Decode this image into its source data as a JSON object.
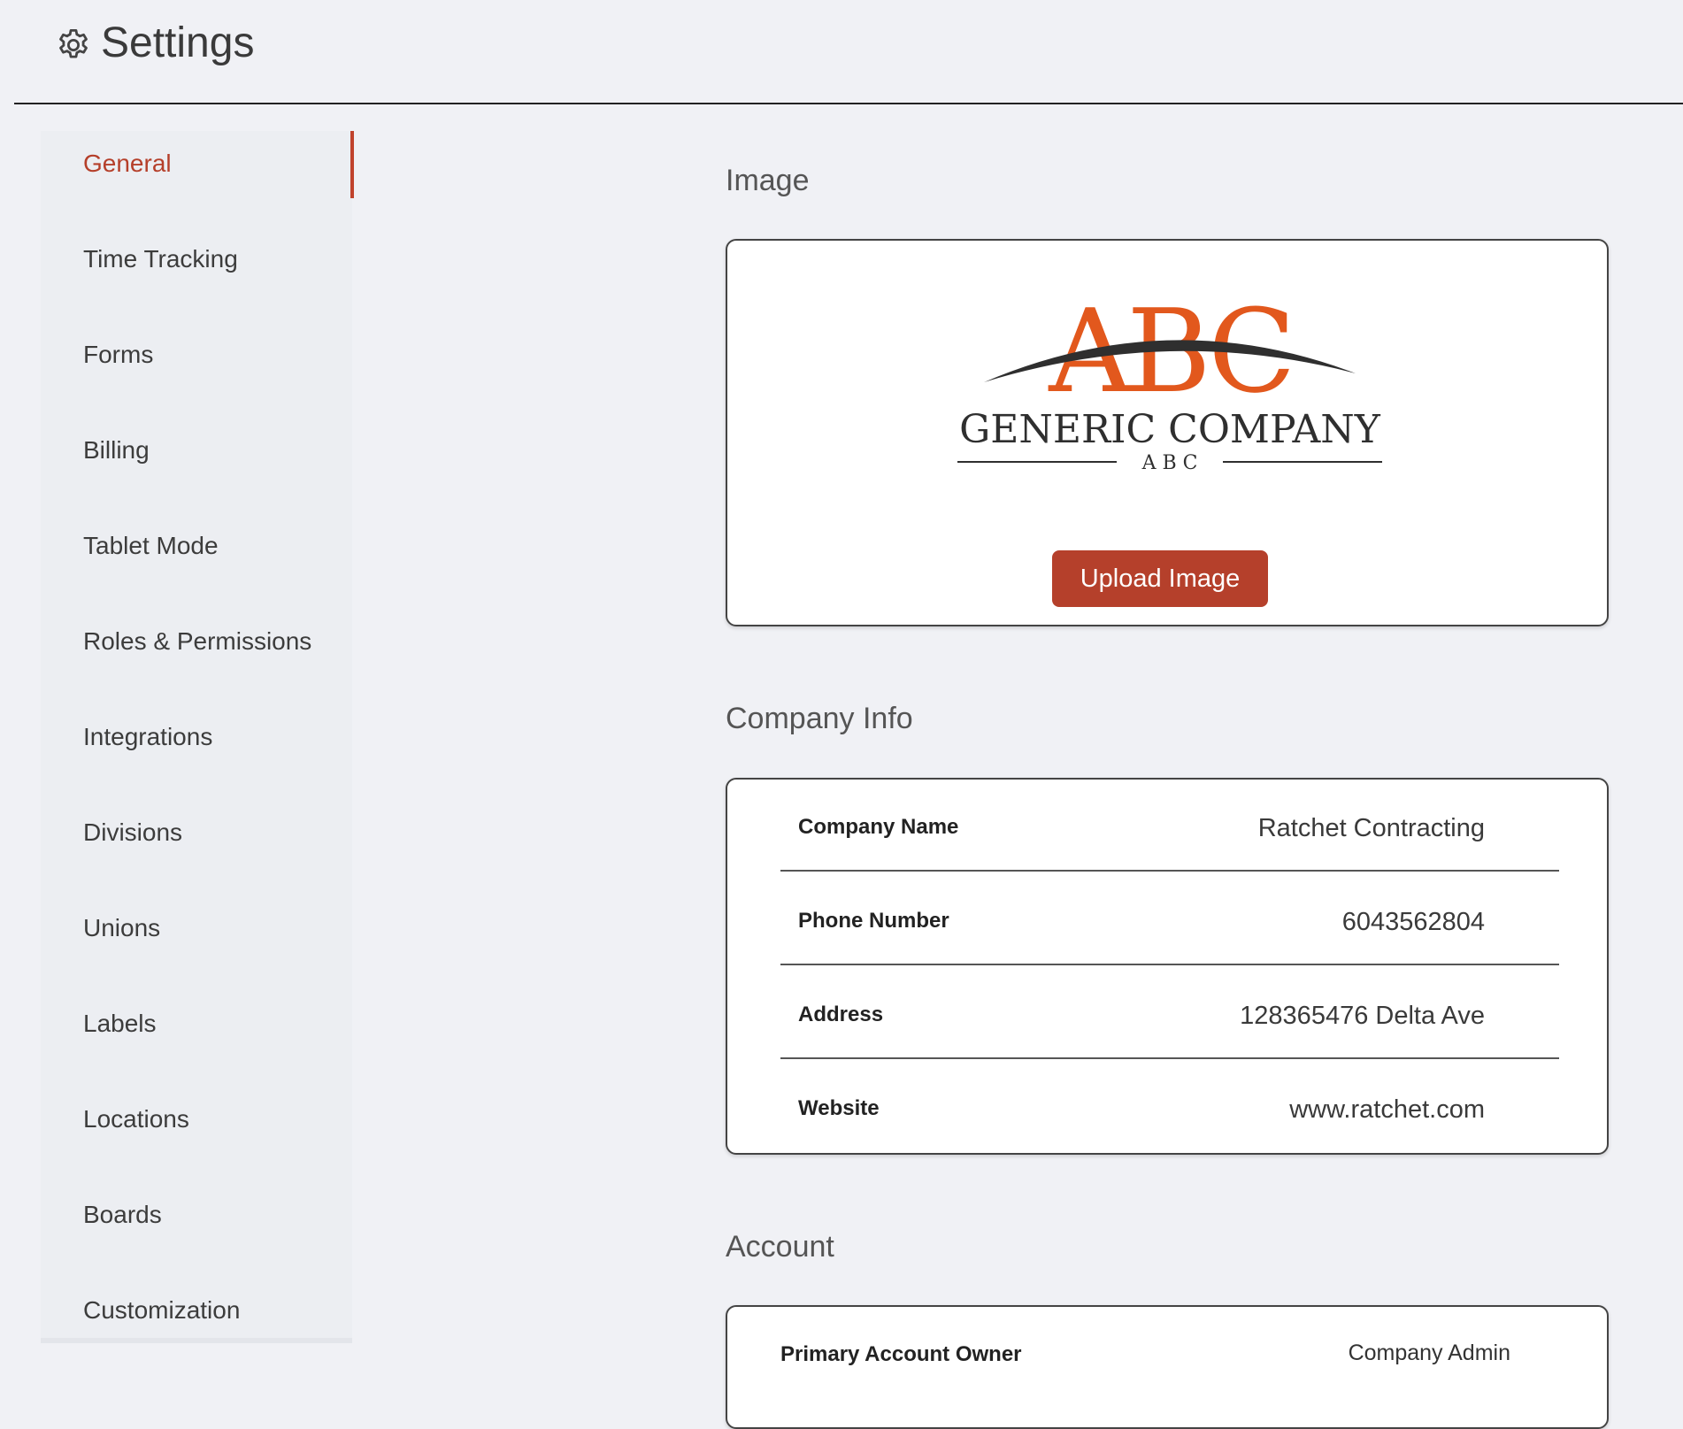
{
  "header": {
    "title": "Settings",
    "icon": "gear-icon"
  },
  "sidebar": {
    "items": [
      {
        "label": "General",
        "active": true
      },
      {
        "label": "Time Tracking"
      },
      {
        "label": "Forms"
      },
      {
        "label": "Billing"
      },
      {
        "label": "Tablet Mode"
      },
      {
        "label": "Roles & Permissions"
      },
      {
        "label": "Integrations"
      },
      {
        "label": "Divisions"
      },
      {
        "label": "Unions"
      },
      {
        "label": "Labels"
      },
      {
        "label": "Locations"
      },
      {
        "label": "Boards"
      },
      {
        "label": "Customization"
      }
    ]
  },
  "image_section": {
    "title": "Image",
    "logo": {
      "mark": "ABC",
      "company": "GENERIC COMPANY",
      "sub": "A B C"
    },
    "upload_label": "Upload Image"
  },
  "company_info": {
    "title": "Company Info",
    "rows": [
      {
        "label": "Company Name",
        "value": "Ratchet Contracting"
      },
      {
        "label": "Phone Number",
        "value": "6043562804"
      },
      {
        "label": "Address",
        "value": "128365476 Delta Ave"
      },
      {
        "label": "Website",
        "value": "www.ratchet.com"
      }
    ]
  },
  "account": {
    "title": "Account",
    "rows": [
      {
        "label": "Primary Account Owner",
        "value": "Company Admin"
      }
    ]
  },
  "colors": {
    "accent": "#b5402b",
    "logo_orange": "#e2581d",
    "logo_dark": "#2f2f2f",
    "background": "#f0f1f5"
  }
}
